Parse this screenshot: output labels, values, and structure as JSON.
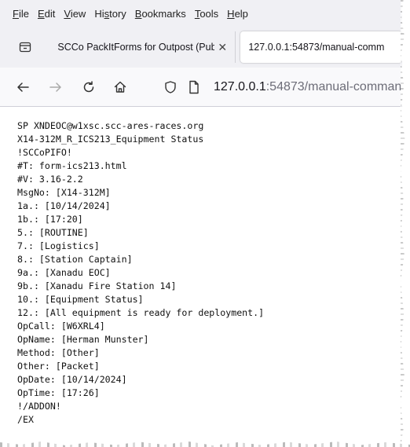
{
  "menu": [
    "File",
    "Edit",
    "View",
    "History",
    "Bookmarks",
    "Tools",
    "Help"
  ],
  "tabs": {
    "inactive_title": "SCCo PackItForms for Outpost (Publ",
    "active_title": "127.0.0.1:54873/manual-comm"
  },
  "url": {
    "host": "127.0.0.1",
    "rest": ":54873/manual-comman"
  },
  "message_lines": [
    "SP XNDEOC@w1xsc.scc-ares-races.org",
    "X14-312M_R_ICS213_Equipment Status",
    "!SCCoPIFO!",
    "#T: form-ics213.html",
    "#V: 3.16-2.2",
    "MsgNo: [X14-312M]",
    "1a.: [10/14/2024]",
    "1b.: [17:20]",
    "5.: [ROUTINE]",
    "7.: [Logistics]",
    "8.: [Station Captain]",
    "9a.: [Xanadu EOC]",
    "9b.: [Xanadu Fire Station 14]",
    "10.: [Equipment Status]",
    "12.: [All equipment is ready for deployment.]",
    "OpCall: [W6XRL4]",
    "OpName: [Herman Munster]",
    "Method: [Other]",
    "Other: [Packet]",
    "OpDate: [10/14/2024]",
    "OpTime: [17:26]",
    "!/ADDON!",
    "/EX"
  ],
  "icons": {
    "tab_list": "tab-list-icon",
    "back": "back-arrow-icon",
    "forward": "forward-arrow-icon",
    "reload": "reload-icon",
    "home": "home-icon",
    "shield": "shield-icon",
    "page": "page-icon"
  }
}
